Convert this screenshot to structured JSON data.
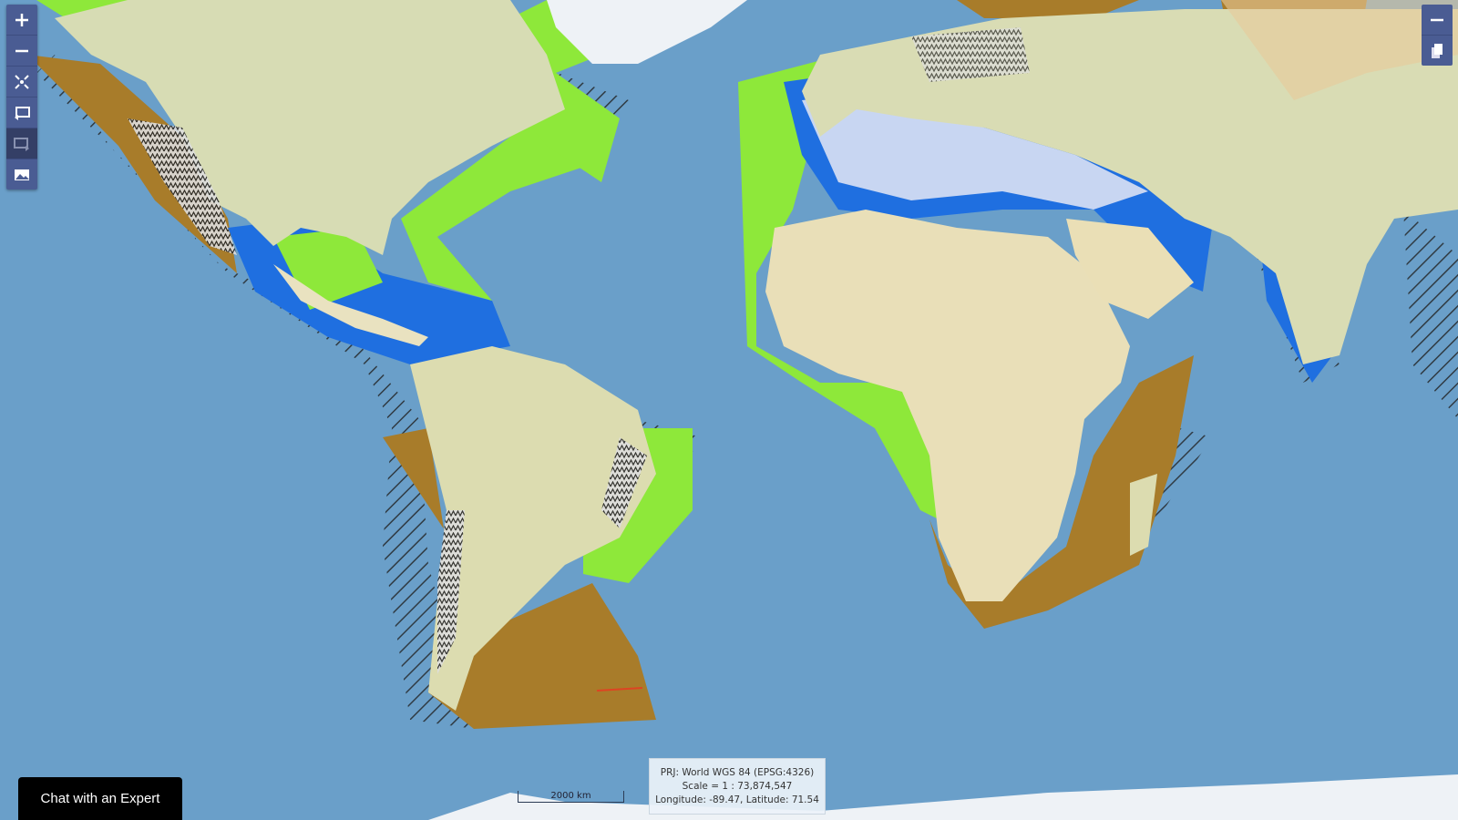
{
  "map": {
    "colors": {
      "ocean": "#6a9fc9",
      "land": "#e9e2c0",
      "land_green": "#c9d6a8",
      "shelf_lime": "#8ee83a",
      "shelf_brown": "#a87c2a",
      "shelf_blue": "#1f6fe0",
      "shelf_light": "#c8d6f2",
      "sand": "#e8c99a",
      "ice": "#eef2f6"
    }
  },
  "toolbar": {
    "items": [
      {
        "name": "zoom-in",
        "icon": "plus-icon"
      },
      {
        "name": "zoom-out",
        "icon": "minus-icon"
      },
      {
        "name": "full-extent",
        "icon": "expand-icon"
      },
      {
        "name": "previous-extent",
        "icon": "back-extent-icon"
      },
      {
        "name": "next-extent",
        "icon": "forward-extent-icon"
      },
      {
        "name": "export-image",
        "icon": "image-icon"
      }
    ]
  },
  "top_right": {
    "items": [
      {
        "name": "collapse",
        "icon": "minus-icon"
      },
      {
        "name": "layers",
        "icon": "copy-icon"
      }
    ]
  },
  "scalebar": {
    "label": "2000 km"
  },
  "info": {
    "projection": "PRJ: World WGS 84 (EPSG:4326)",
    "scale": "Scale = 1 : 73,874,547",
    "coords": "Longitude: -89.47, Latitude: 71.54"
  },
  "chat": {
    "label": "Chat with an Expert"
  }
}
